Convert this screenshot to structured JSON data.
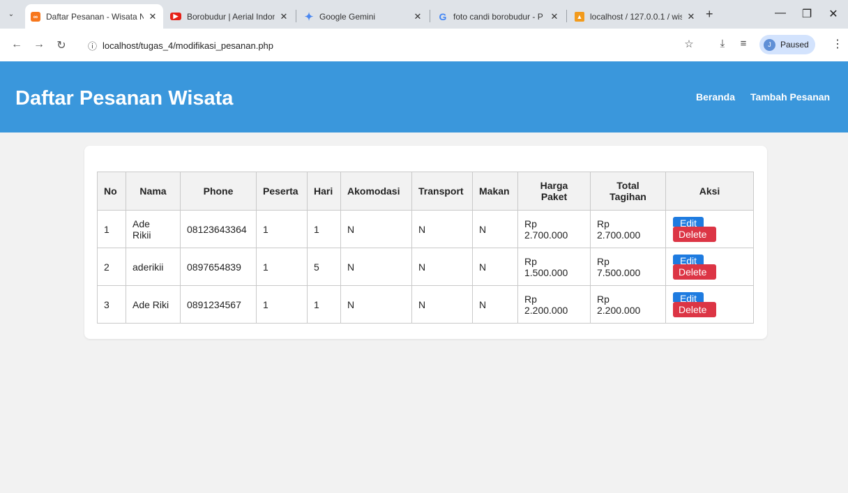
{
  "browser": {
    "tabs": [
      {
        "title": "Daftar Pesanan - Wisata N",
        "favicon": "xampp-icon",
        "color": "#f7771c",
        "active": true
      },
      {
        "title": "Borobudur | Aerial Indone",
        "favicon": "youtube-icon",
        "color": "#e62117",
        "active": false
      },
      {
        "title": "Google Gemini",
        "favicon": "gemini-icon",
        "color": "#4b88f0",
        "active": false
      },
      {
        "title": "foto candi borobudur - P",
        "favicon": "google-icon",
        "color": "#4285f4",
        "active": false
      },
      {
        "title": "localhost / 127.0.0.1 / wis",
        "favicon": "phpmyadmin-icon",
        "color": "#f29b1d",
        "active": false
      }
    ],
    "url": "localhost/tugas_4/modifikasi_pesanan.php",
    "profile_initial": "J",
    "profile_status": "Paused"
  },
  "header": {
    "title": "Daftar Pesanan Wisata",
    "nav": [
      "Beranda",
      "Tambah Pesanan"
    ],
    "color": "#3a97dc"
  },
  "table": {
    "columns": [
      "No",
      "Nama",
      "Phone",
      "Peserta",
      "Hari",
      "Akomodasi",
      "Transport",
      "Makan",
      "Harga\nPaket",
      "Total\nTagihan",
      "Aksi"
    ],
    "rows": [
      {
        "no": "1",
        "nama": "Ade\nRikii",
        "phone": "08123643364",
        "peserta": "1",
        "hari": "1",
        "akomodasi": "N",
        "transport": "N",
        "makan": "N",
        "harga": "Rp\n2.700.000",
        "total": "Rp\n2.700.000"
      },
      {
        "no": "2",
        "nama": "aderikii",
        "phone": "0897654839",
        "peserta": "1",
        "hari": "5",
        "akomodasi": "N",
        "transport": "N",
        "makan": "N",
        "harga": "Rp\n1.500.000",
        "total": "Rp\n7.500.000"
      },
      {
        "no": "3",
        "nama": "Ade Riki",
        "phone": "0891234567",
        "peserta": "1",
        "hari": "1",
        "akomodasi": "N",
        "transport": "N",
        "makan": "N",
        "harga": "Rp\n2.200.000",
        "total": "Rp\n2.200.000"
      }
    ],
    "actions": {
      "edit": "Edit",
      "delete": "Delete",
      "edit_color": "#1e7be0",
      "delete_color": "#dc3545"
    }
  }
}
